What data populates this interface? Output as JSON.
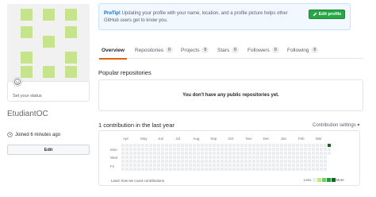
{
  "profile": {
    "username": "EtudiantOC",
    "status_label": "Set your status",
    "joined": "Joined 6 minutes ago",
    "edit_label": "Edit"
  },
  "protip": {
    "lead": "ProTip!",
    "text": "Updating your profile with your name, location, and a profile picture helps other GitHub users get to know you.",
    "button_label": "Edit profile"
  },
  "tabs": [
    {
      "label": "Overview",
      "count": ""
    },
    {
      "label": "Repositories",
      "count": "0"
    },
    {
      "label": "Projects",
      "count": "0"
    },
    {
      "label": "Stars",
      "count": "0"
    },
    {
      "label": "Followers",
      "count": "0"
    },
    {
      "label": "Following",
      "count": "0"
    }
  ],
  "popular": {
    "title": "Popular repositories",
    "empty_text": "You don't have any public repositories yet."
  },
  "contributions": {
    "title": "1 contribution in the last year",
    "settings_label": "Contribution settings ▾",
    "months": [
      "Apr",
      "May",
      "Jun",
      "Jul",
      "Aug",
      "Sep",
      "Oct",
      "Nov",
      "Dec",
      "Jan",
      "Feb",
      "Mar"
    ],
    "days": [
      "Mon",
      "Wed",
      "Fri"
    ],
    "learn_link": "Learn how we count contributions.",
    "less_label": "Less",
    "more_label": "More",
    "legend_colors": [
      "#ebedf0",
      "#c6e48b",
      "#7bc96f",
      "#239a3b",
      "#196127"
    ]
  },
  "colors": {
    "accent": "#0366d6",
    "success": "#28a745",
    "avatar_fill": "#c6e48b",
    "selected_tab": "#e36209"
  }
}
